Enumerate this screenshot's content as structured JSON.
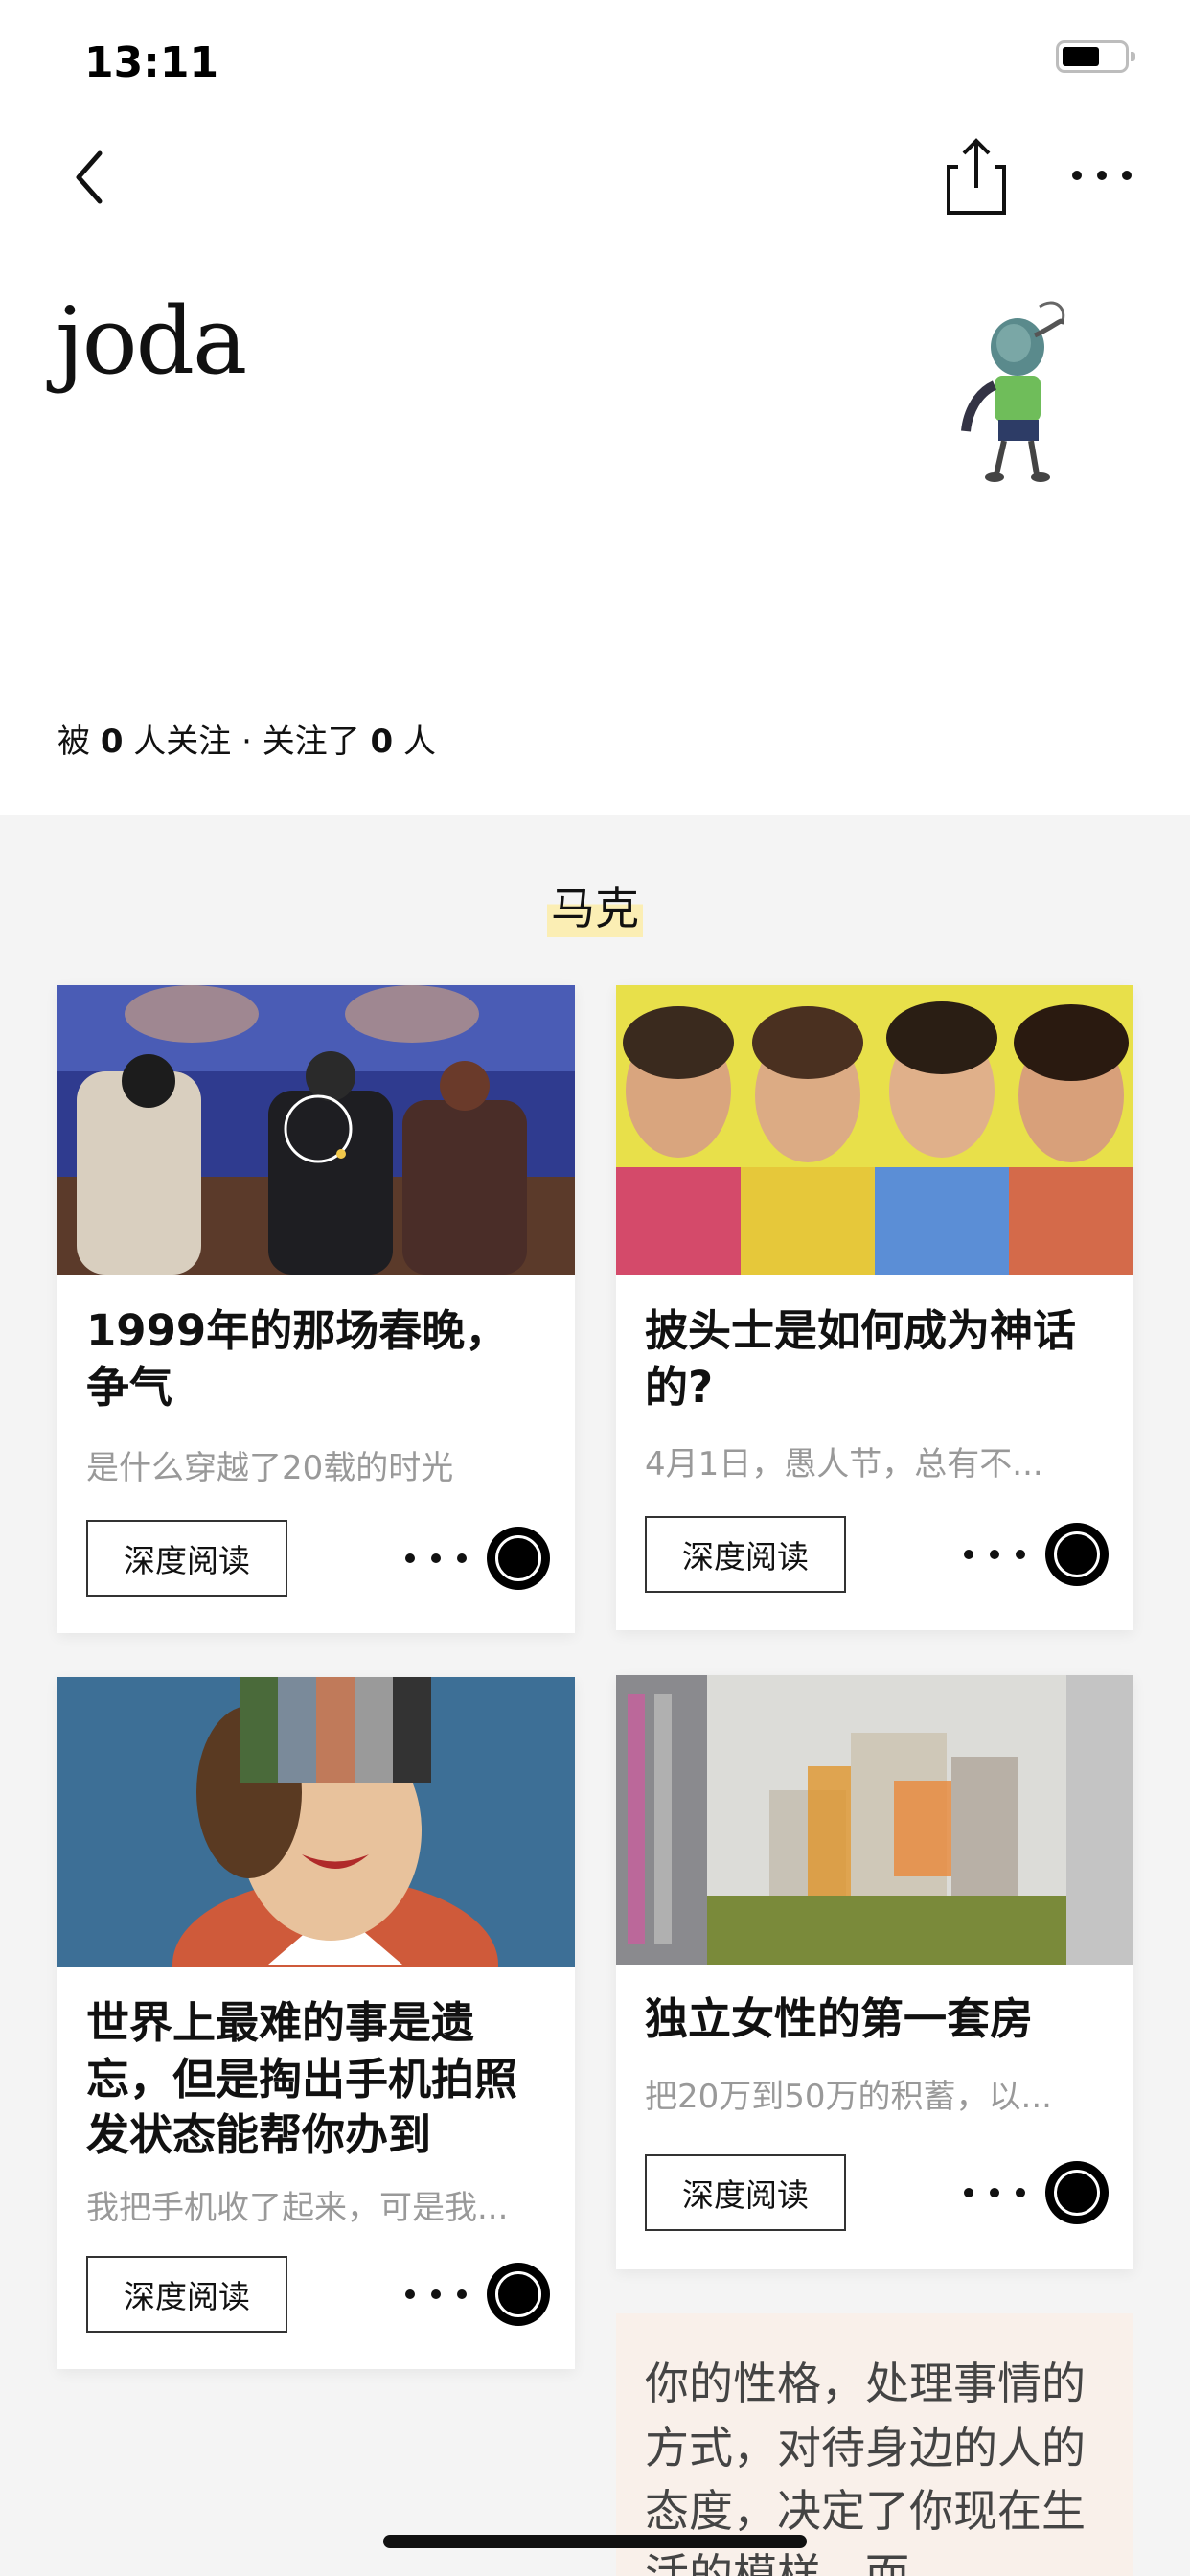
{
  "status_bar": {
    "time": "13:11"
  },
  "profile": {
    "username": "joda",
    "followers_prefix": "被",
    "followers_count": "0",
    "followers_suffix": "人关注 · 关注了",
    "following_count": "0",
    "following_suffix": "人"
  },
  "section": {
    "title": "马克"
  },
  "cards": [
    {
      "title": "1999年的那场春晚，争气",
      "subtitle": "是什么穿越了20载的时光",
      "button": "深度阅读"
    },
    {
      "title": "披头士是如何成为神话的?",
      "subtitle": "4月1日，愚人节，总有不...",
      "button": "深度阅读"
    },
    {
      "title": "世界上最难的事是遗忘，但是掏出手机拍照发状态能帮你办到",
      "subtitle": "我把手机收了起来，可是我...",
      "button": "深度阅读"
    },
    {
      "title": "独立女性的第一套房",
      "subtitle": "把20万到50万的积蓄，以...",
      "button": "深度阅读"
    }
  ],
  "quote_card": {
    "text": "你的性格，处理事情的方式，对待身边的人的态度，决定了你现在生活的模样。而"
  },
  "colors": {
    "highlight": "#fbeeb4",
    "quote_bg": "#f9f0ea",
    "page_bg": "#f4f4f4"
  }
}
